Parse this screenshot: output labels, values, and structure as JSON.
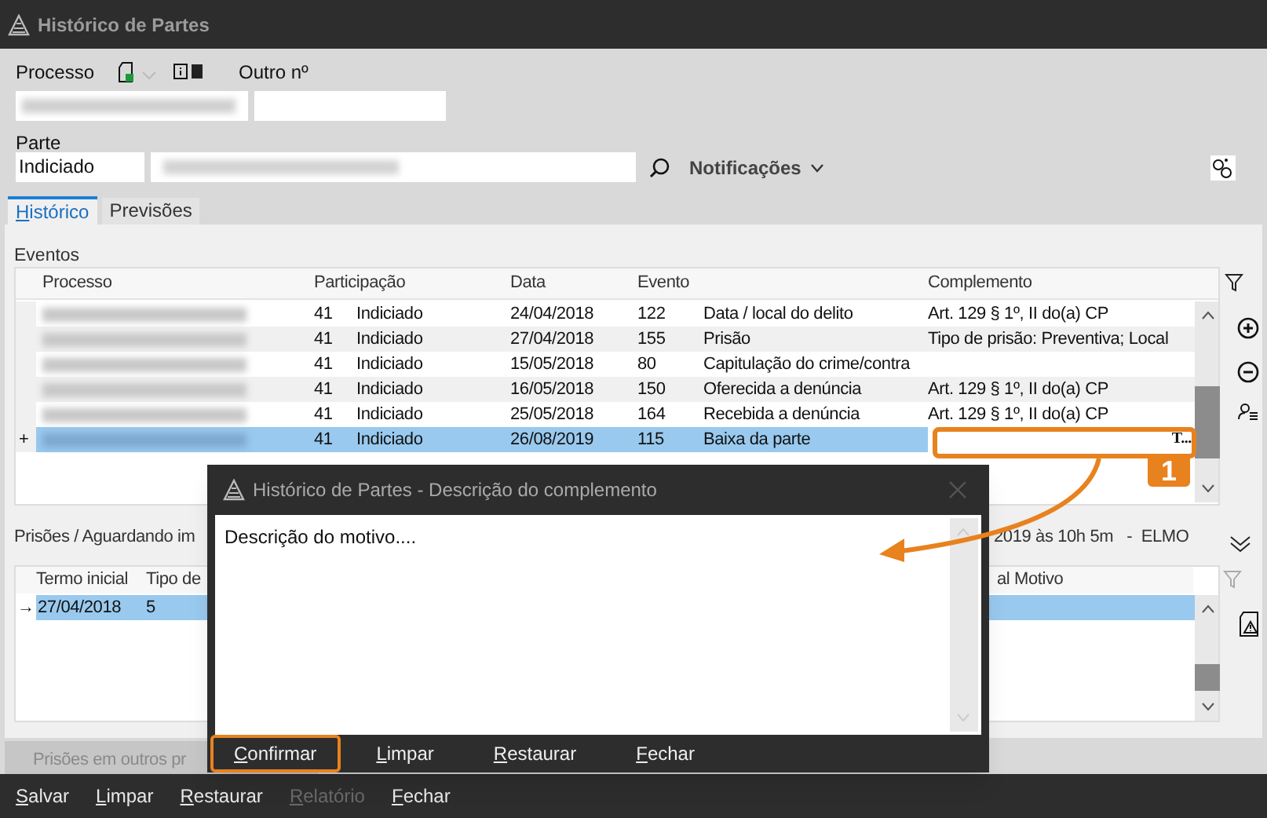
{
  "window": {
    "title": "Histórico de Partes"
  },
  "header": {
    "processo_label": "Processo",
    "outro_label": "Outro nº",
    "parte_label": "Parte",
    "parte_value": "Indiciado",
    "notifications": "Notificações"
  },
  "tabs": [
    {
      "label": "Histórico",
      "selected": true
    },
    {
      "label": "Previsões",
      "selected": false
    }
  ],
  "eventos": {
    "label": "Eventos",
    "columns": [
      "Processo",
      "Participação",
      "Data",
      "Evento",
      "Complemento"
    ],
    "rows": [
      {
        "code": "41",
        "participacao": "Indiciado",
        "data": "24/04/2018",
        "evento_code": "122",
        "evento": "Data / local do delito",
        "complemento": "Art. 129 § 1º, II do(a) CP",
        "selected": false
      },
      {
        "code": "41",
        "participacao": "Indiciado",
        "data": "27/04/2018",
        "evento_code": "155",
        "evento": "Prisão",
        "complemento": "Tipo de prisão: Preventiva; Local",
        "selected": false
      },
      {
        "code": "41",
        "participacao": "Indiciado",
        "data": "15/05/2018",
        "evento_code": "80",
        "evento": "Capitulação do crime/contra",
        "selected": false
      },
      {
        "code": "41",
        "participacao": "Indiciado",
        "data": "16/05/2018",
        "evento_code": "150",
        "evento": "Oferecida a denúncia",
        "complemento": "Art. 129 § 1º, II do(a) CP",
        "selected": false
      },
      {
        "code": "41",
        "participacao": "Indiciado",
        "data": "25/05/2018",
        "evento_code": "164",
        "evento": "Recebida a denúncia",
        "complemento": "Art. 129 § 1º, II do(a) CP",
        "selected": false
      },
      {
        "marker": "+",
        "code": "41",
        "participacao": "Indiciado",
        "data": "26/08/2019",
        "evento_code": "115",
        "evento": "Baixa da parte",
        "editor_button": "T...",
        "selected": true
      }
    ]
  },
  "prisoes": {
    "label": "Prisões / Aguardando im",
    "info": "2019 às 10h 5m   -  ELMO",
    "columns": [
      "Termo inicial",
      "Tipo de",
      "al Motivo"
    ],
    "rows": [
      {
        "marker": "→",
        "termo": "27/04/2018",
        "tipo": "5",
        "selected": true
      }
    ]
  },
  "other_button": {
    "label": "Prisões em outros pr",
    "disabled": true
  },
  "toolbar": [
    {
      "label": "Salvar",
      "disabled": false
    },
    {
      "label": "Limpar",
      "disabled": false
    },
    {
      "label": "Restaurar",
      "disabled": false
    },
    {
      "label": "Relatório",
      "disabled": true
    },
    {
      "label": "Fechar",
      "disabled": false
    }
  ],
  "dialog": {
    "title": "Histórico de Partes - Descrição do complemento",
    "text": "Descrição do motivo....",
    "buttons": [
      {
        "label": "Confirmar",
        "highlighted": true
      },
      {
        "label": "Limpar",
        "highlighted": false
      },
      {
        "label": "Restaurar",
        "highlighted": false
      },
      {
        "label": "Fechar",
        "highlighted": false
      }
    ]
  },
  "annotation": {
    "number": "1"
  }
}
